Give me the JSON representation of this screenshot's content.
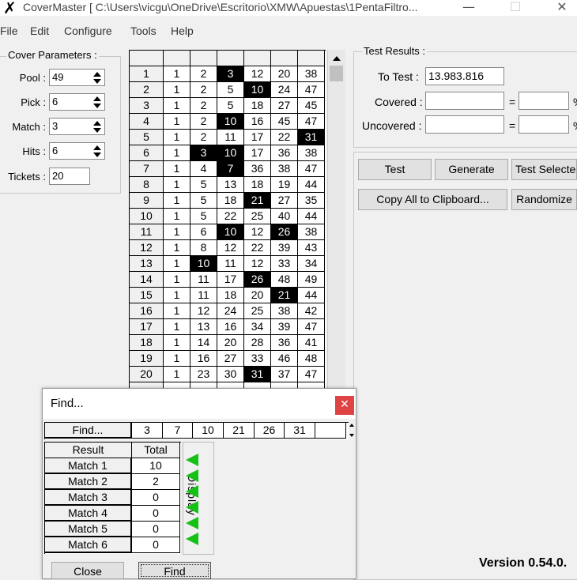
{
  "window": {
    "title": "CoverMaster [ C:\\Users\\vicgu\\OneDrive\\Escritorio\\XMW\\Apuestas\\1PentaFiltro...",
    "minimize_glyph": "—",
    "maximize_glyph": "☐",
    "close_glyph": "✕"
  },
  "menu": [
    "File",
    "Edit",
    "Configure",
    "Tools",
    "Help"
  ],
  "cover_parameters": {
    "title": "Cover Parameters :",
    "fields": [
      {
        "label": "Pool :",
        "value": "49"
      },
      {
        "label": "Pick :",
        "value": "6"
      },
      {
        "label": "Match :",
        "value": "3"
      },
      {
        "label": "Hits :",
        "value": "6"
      }
    ],
    "tickets_label": "Tickets :",
    "tickets_value": "20"
  },
  "tickets_grid": {
    "rows": [
      {
        "n": "1",
        "v": [
          "1",
          "2",
          "3",
          "12",
          "20",
          "38"
        ]
      },
      {
        "n": "2",
        "v": [
          "1",
          "2",
          "5",
          "10",
          "24",
          "47"
        ]
      },
      {
        "n": "3",
        "v": [
          "1",
          "2",
          "5",
          "18",
          "27",
          "45"
        ]
      },
      {
        "n": "4",
        "v": [
          "1",
          "2",
          "10",
          "16",
          "45",
          "47"
        ]
      },
      {
        "n": "5",
        "v": [
          "1",
          "2",
          "11",
          "17",
          "22",
          "31"
        ]
      },
      {
        "n": "6",
        "v": [
          "1",
          "3",
          "10",
          "17",
          "36",
          "38"
        ]
      },
      {
        "n": "7",
        "v": [
          "1",
          "4",
          "7",
          "36",
          "38",
          "47"
        ]
      },
      {
        "n": "8",
        "v": [
          "1",
          "5",
          "13",
          "18",
          "19",
          "44"
        ]
      },
      {
        "n": "9",
        "v": [
          "1",
          "5",
          "18",
          "21",
          "27",
          "35"
        ]
      },
      {
        "n": "10",
        "v": [
          "1",
          "5",
          "22",
          "25",
          "40",
          "44"
        ]
      },
      {
        "n": "11",
        "v": [
          "1",
          "6",
          "10",
          "12",
          "26",
          "38"
        ]
      },
      {
        "n": "12",
        "v": [
          "1",
          "8",
          "12",
          "22",
          "39",
          "43"
        ]
      },
      {
        "n": "13",
        "v": [
          "1",
          "10",
          "11",
          "12",
          "33",
          "34"
        ]
      },
      {
        "n": "14",
        "v": [
          "1",
          "11",
          "17",
          "26",
          "48",
          "49"
        ]
      },
      {
        "n": "15",
        "v": [
          "1",
          "11",
          "18",
          "20",
          "21",
          "44"
        ]
      },
      {
        "n": "16",
        "v": [
          "1",
          "12",
          "24",
          "25",
          "38",
          "42"
        ]
      },
      {
        "n": "17",
        "v": [
          "1",
          "13",
          "16",
          "34",
          "39",
          "47"
        ]
      },
      {
        "n": "18",
        "v": [
          "1",
          "14",
          "20",
          "28",
          "36",
          "41"
        ]
      },
      {
        "n": "19",
        "v": [
          "1",
          "16",
          "27",
          "33",
          "46",
          "48"
        ]
      },
      {
        "n": "20",
        "v": [
          "1",
          "23",
          "30",
          "31",
          "37",
          "47"
        ]
      }
    ],
    "highlighted_numbers": [
      "3",
      "7",
      "10",
      "21",
      "26",
      "31"
    ]
  },
  "test_results": {
    "title": "Test Results :",
    "to_test_label": "To Test :",
    "to_test_value": "13.983.816",
    "covered_label": "Covered :",
    "uncovered_label": "Uncovered :",
    "equals": "=",
    "percent": "%"
  },
  "buttons": {
    "test": "Test",
    "generate": "Generate",
    "test_selected": "Test Selected",
    "copy_all": "Copy All to Clipboard...",
    "randomize": "Randomize"
  },
  "version": "Version 0.54.0.",
  "find_dialog": {
    "title": "Find...",
    "close_glyph": "✕",
    "find_button": "Find...",
    "numbers": [
      "3",
      "7",
      "10",
      "21",
      "26",
      "31",
      ""
    ],
    "result_header": "Result",
    "total_header": "Total",
    "results": [
      {
        "label": "Match 1",
        "total": "10"
      },
      {
        "label": "Match 2",
        "total": "2"
      },
      {
        "label": "Match 3",
        "total": "0"
      },
      {
        "label": "Match 4",
        "total": "0"
      },
      {
        "label": "Match 5",
        "total": "0"
      },
      {
        "label": "Match 6",
        "total": "0"
      }
    ],
    "display_label": "Display",
    "close_button": "Close",
    "find_action_button": "Find",
    "indicator_color": "#16c116"
  }
}
